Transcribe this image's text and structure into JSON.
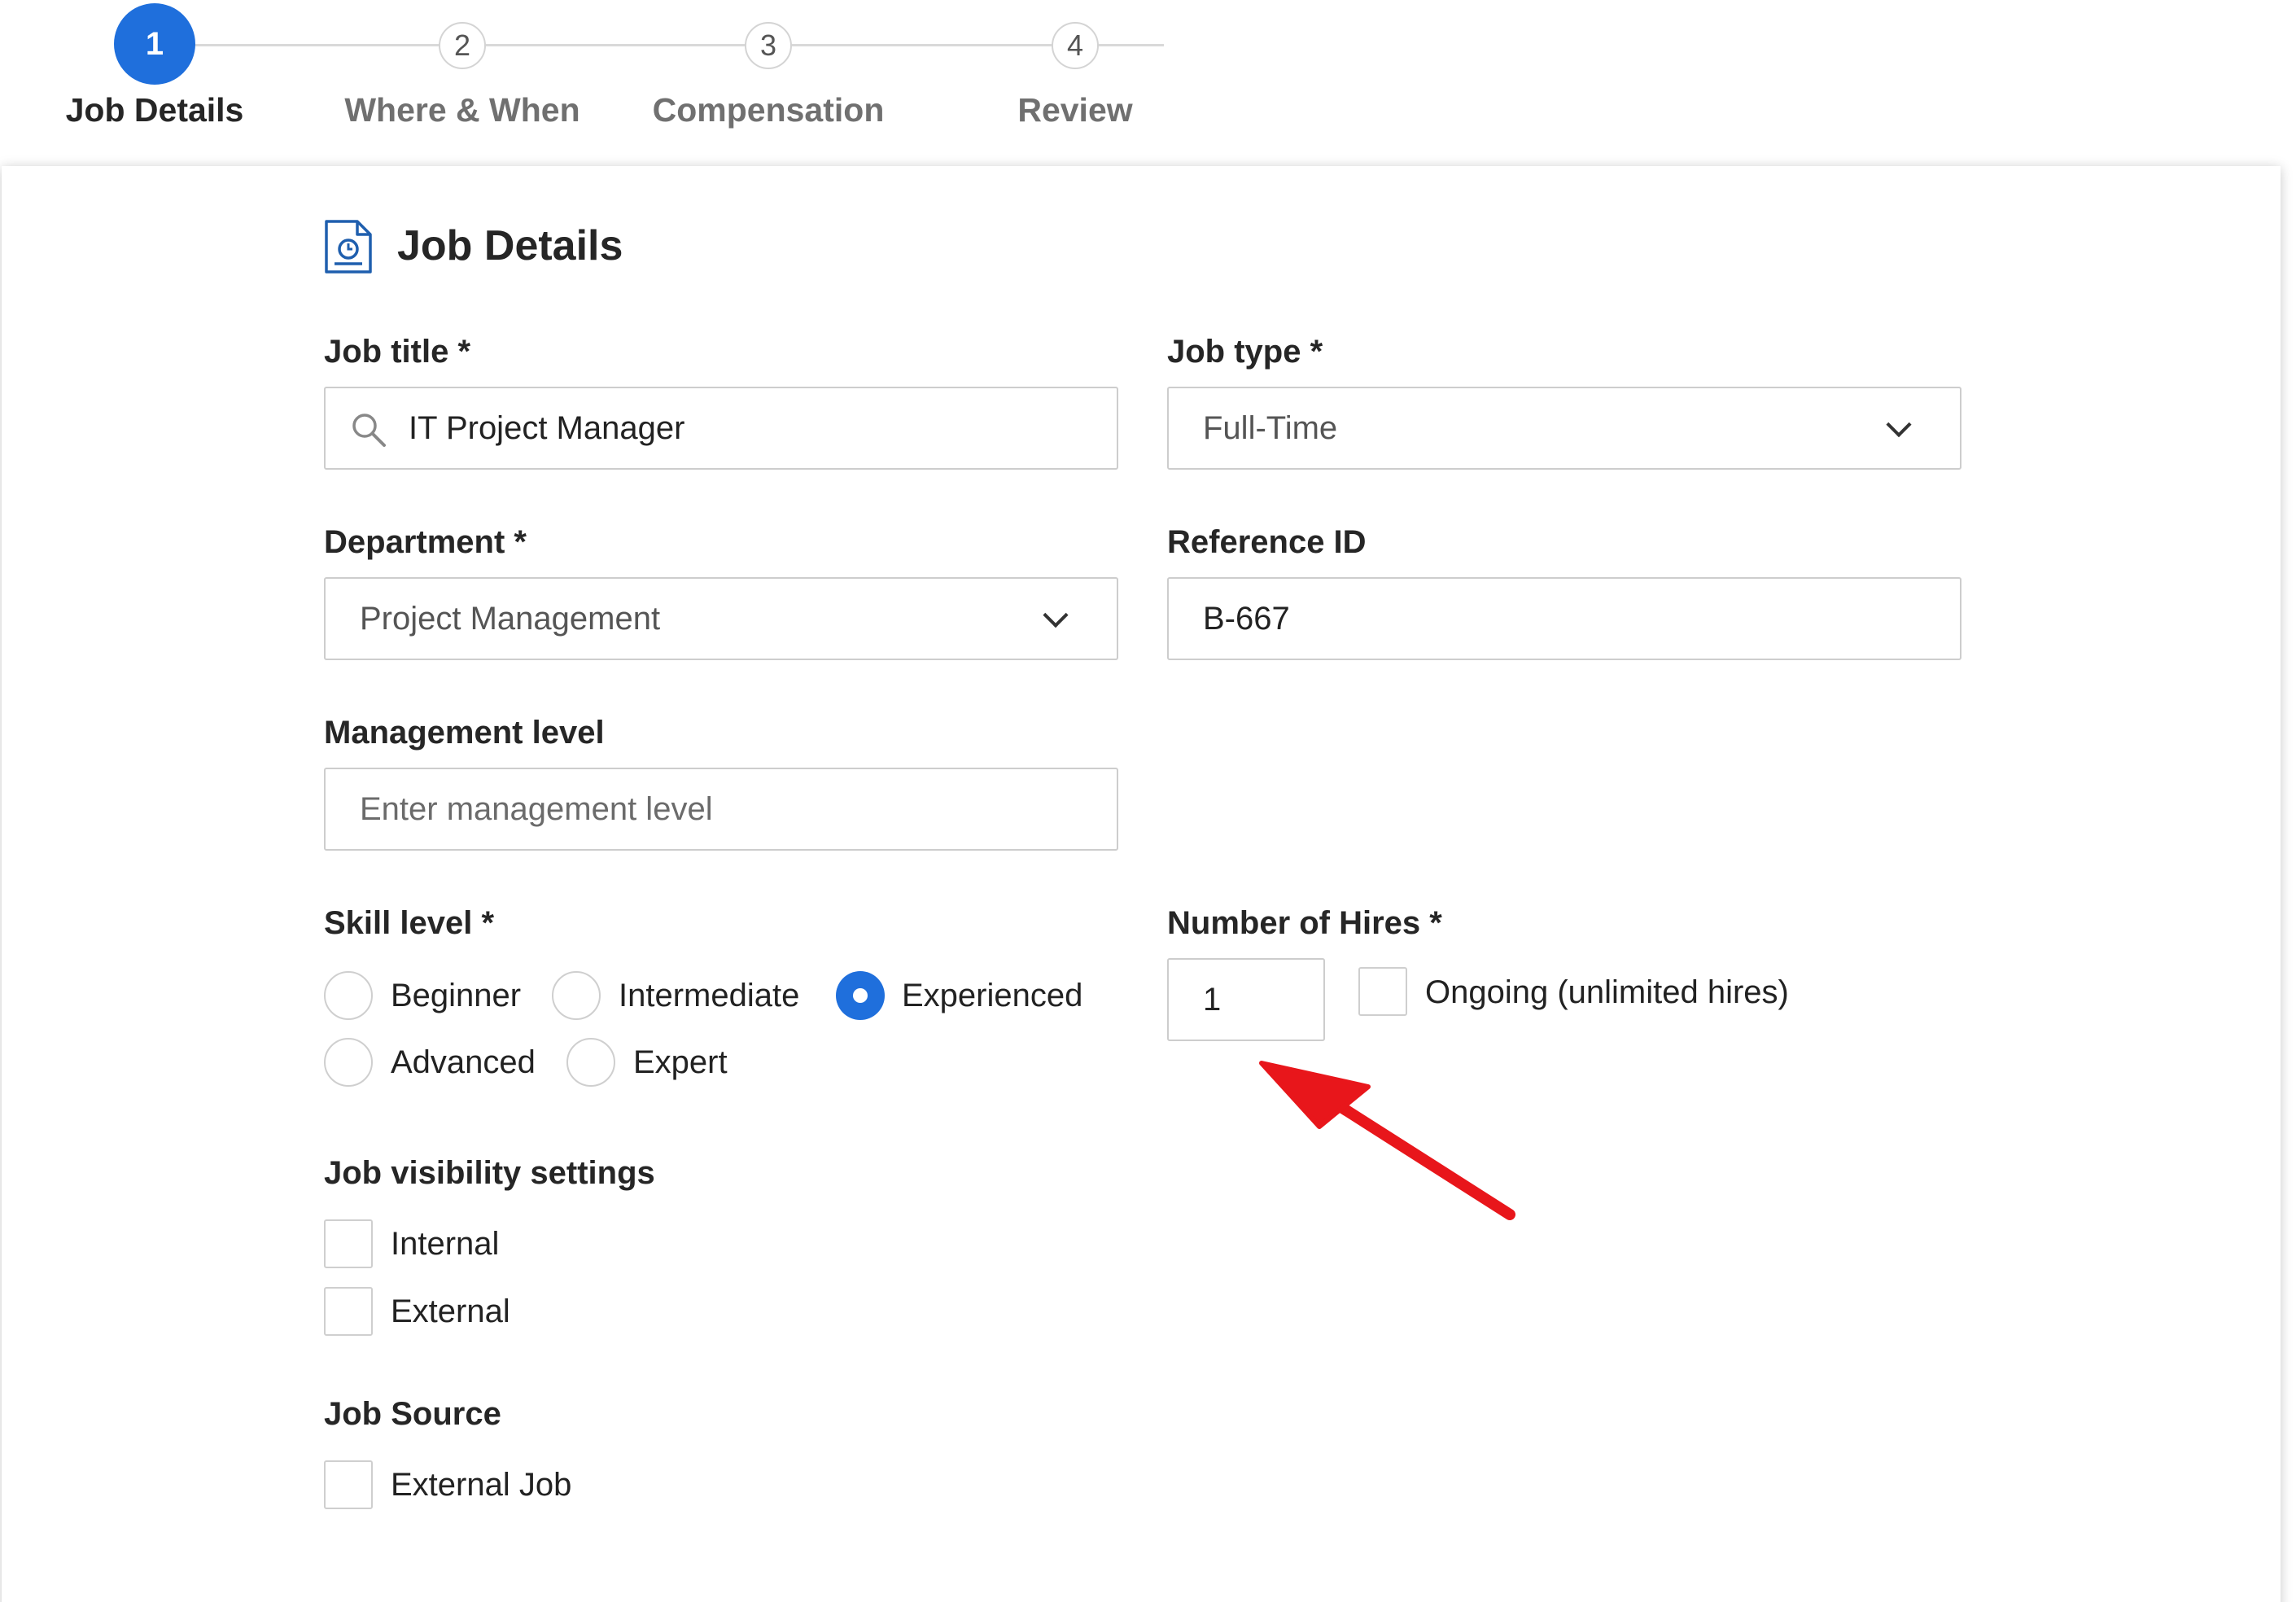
{
  "stepper": {
    "steps": [
      {
        "number": "1",
        "label": "Job Details",
        "active": true
      },
      {
        "number": "2",
        "label": "Where & When",
        "active": false
      },
      {
        "number": "3",
        "label": "Compensation",
        "active": false
      },
      {
        "number": "4",
        "label": "Review",
        "active": false
      }
    ]
  },
  "form": {
    "title": "Job Details",
    "icon": "document-clock-icon",
    "job_title": {
      "label": "Job title *",
      "value": "IT Project Manager",
      "icon": "search-icon"
    },
    "job_type": {
      "label": "Job type *",
      "value": "Full-Time"
    },
    "department": {
      "label": "Department *",
      "value": "Project Management"
    },
    "reference_id": {
      "label": "Reference ID",
      "value": "B-667"
    },
    "management_level": {
      "label": "Management level",
      "placeholder": "Enter management level"
    },
    "skill_level": {
      "label": "Skill level *",
      "options": [
        "Beginner",
        "Intermediate",
        "Experienced",
        "Advanced",
        "Expert"
      ],
      "selected": "Experienced"
    },
    "number_of_hires": {
      "label": "Number of Hires *",
      "value": "1",
      "ongoing_label": "Ongoing (unlimited hires)",
      "ongoing_checked": false
    },
    "visibility": {
      "label": "Job visibility settings",
      "options": [
        "Internal",
        "External"
      ]
    },
    "source": {
      "label": "Job Source",
      "options": [
        "External Job"
      ]
    }
  },
  "colors": {
    "accent": "#1f6fdc",
    "annotation_arrow": "#e8161b"
  }
}
